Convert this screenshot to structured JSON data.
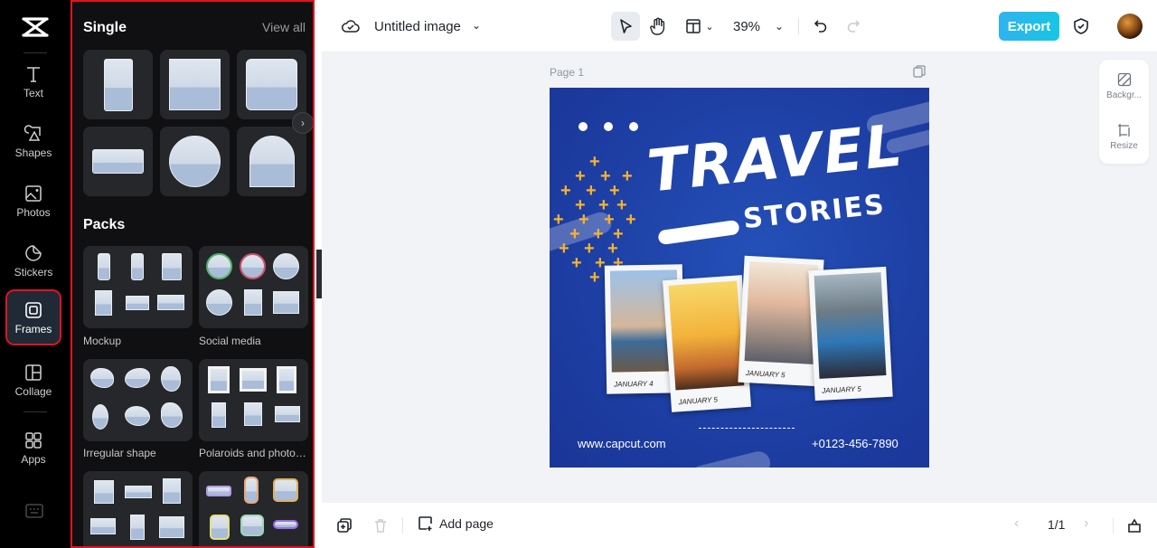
{
  "app": {
    "name": "CapCut"
  },
  "rail": {
    "items": [
      {
        "id": "text",
        "label": "Text",
        "icon": "text-icon"
      },
      {
        "id": "shapes",
        "label": "Shapes",
        "icon": "shapes-icon"
      },
      {
        "id": "photos",
        "label": "Photos",
        "icon": "photo-icon"
      },
      {
        "id": "stickers",
        "label": "Stickers",
        "icon": "sticker-icon"
      },
      {
        "id": "frames",
        "label": "Frames",
        "icon": "frame-icon",
        "active": true
      },
      {
        "id": "collage",
        "label": "Collage",
        "icon": "collage-icon"
      },
      {
        "id": "apps",
        "label": "Apps",
        "icon": "apps-icon"
      }
    ]
  },
  "panel": {
    "single": {
      "title": "Single",
      "view_all": "View all",
      "shapes": [
        "portrait-rect",
        "square",
        "rounded-square",
        "landscape",
        "circle",
        "arch"
      ]
    },
    "packs": {
      "title": "Packs",
      "items": [
        {
          "label": "Mockup"
        },
        {
          "label": "Social media"
        },
        {
          "label": "Irregular shape"
        },
        {
          "label": "Polaroids and photo f..."
        },
        {
          "label": ""
        },
        {
          "label": ""
        }
      ]
    }
  },
  "topbar": {
    "title": "Untitled image",
    "zoom": "39%",
    "export_label": "Export"
  },
  "canvas": {
    "page_label": "Page 1",
    "design": {
      "title": "TRAVEL",
      "subtitle": "STORIES",
      "photos": [
        {
          "caption": "JANUARY 4"
        },
        {
          "caption": "JANUARY 5"
        },
        {
          "caption": "JANUARY 5"
        },
        {
          "caption": "JANUARY 5"
        }
      ],
      "website": "www.capcut.com",
      "phone": "+0123-456-7890",
      "accent_color": "#f7b32b",
      "background_color": "#1d3ea3"
    }
  },
  "right_panel": {
    "items": [
      {
        "label": "Backgr...",
        "icon": "background-icon"
      },
      {
        "label": "Resize",
        "icon": "resize-icon"
      }
    ]
  },
  "bottombar": {
    "add_page_label": "Add page",
    "pager": "1/1"
  }
}
